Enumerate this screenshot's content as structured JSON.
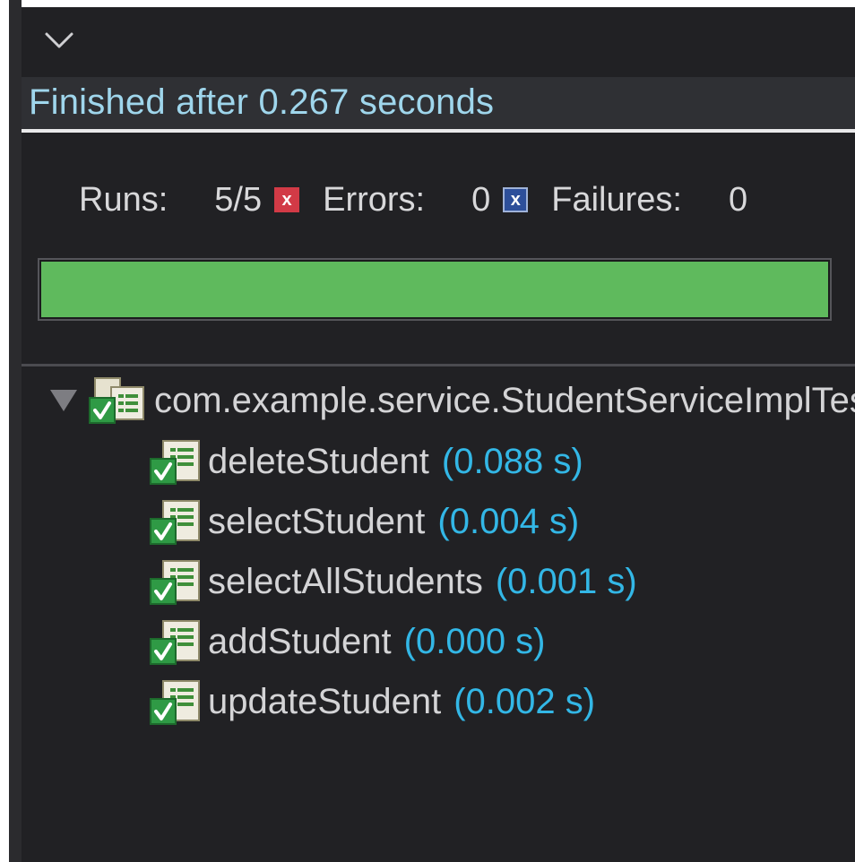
{
  "header": {
    "collapse_icon": "chevron-down-icon",
    "status": "Finished after 0.267 seconds"
  },
  "counters": {
    "runs_label": "Runs:",
    "runs_value": "5/5",
    "errors_label": "Errors:",
    "errors_value": "0",
    "error_icon": "error-x-icon",
    "failures_label": "Failures:",
    "failures_value": "0",
    "failure_icon": "failure-x-icon"
  },
  "progress": {
    "fraction": 1.0,
    "color": "#5fba5d"
  },
  "tree": {
    "suite": {
      "label": "com.example.service.StudentServiceImplTest",
      "icon": "test-suite-passed-icon",
      "expanded": true
    },
    "tests": [
      {
        "name": "deleteStudent",
        "time": "(0.088 s)",
        "icon": "test-passed-icon"
      },
      {
        "name": "selectStudent",
        "time": "(0.004 s)",
        "icon": "test-passed-icon"
      },
      {
        "name": "selectAllStudents",
        "time": "(0.001 s)",
        "icon": "test-passed-icon"
      },
      {
        "name": "addStudent",
        "time": "(0.000 s)",
        "icon": "test-passed-icon"
      },
      {
        "name": "updateStudent",
        "time": "(0.002 s)",
        "icon": "test-passed-icon"
      }
    ]
  },
  "colors": {
    "background": "#212124",
    "status_text": "#9fd6ec",
    "time_text": "#33b7e6",
    "pass_green": "#5fba5d"
  }
}
